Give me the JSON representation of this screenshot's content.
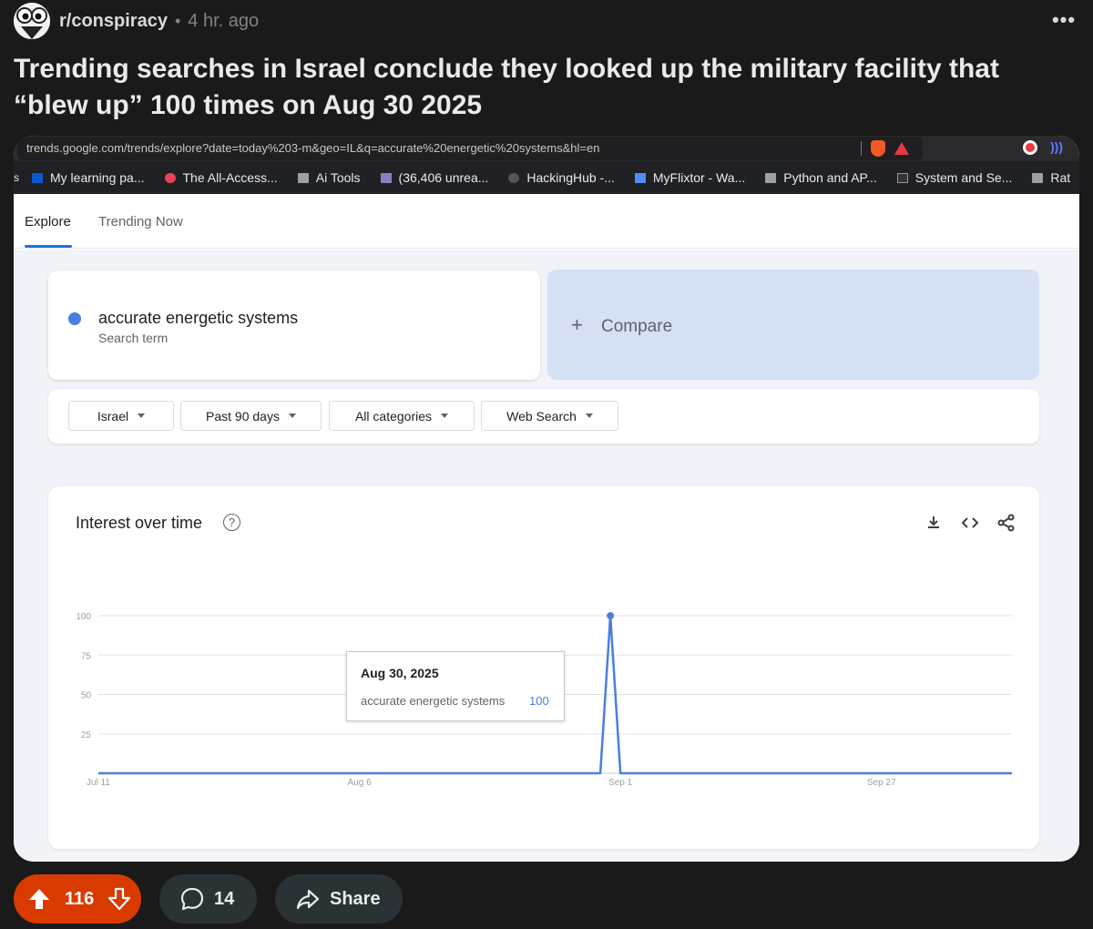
{
  "post": {
    "subreddit": "r/conspiracy",
    "separator": "•",
    "time": "4 hr. ago",
    "more": "•••",
    "title": "Trending searches in Israel conclude they looked up the military facility that “blew up” 100 times on Aug 30 2025",
    "votes": "116",
    "comments": "14",
    "share_label": "Share"
  },
  "browser": {
    "url": "trends.google.com/trends/explore?date=today%203-m&geo=IL&q=accurate%20energetic%20systems&hl=en",
    "bookmarks": [
      {
        "label": "My learning pa..."
      },
      {
        "label": "The All-Access..."
      },
      {
        "label": "Ai Tools"
      },
      {
        "label": "(36,406 unrea..."
      },
      {
        "label": "HackingHub -..."
      },
      {
        "label": "MyFlixtor - Wa..."
      },
      {
        "label": "Python and AP..."
      },
      {
        "label": "System and Se..."
      },
      {
        "label": "Rat"
      }
    ]
  },
  "trends": {
    "tabs": [
      "Explore",
      "Trending Now"
    ],
    "search_term": "accurate energetic systems",
    "search_term_sub": "Search term",
    "compare_label": "Compare",
    "filters": {
      "region": "Israel",
      "period": "Past 90 days",
      "category": "All categories",
      "source": "Web Search"
    },
    "card_title": "Interest over time",
    "help": "?"
  },
  "chart_data": {
    "type": "line",
    "series": [
      {
        "name": "accurate energetic systems",
        "color": "#4a7fe0",
        "x_days": [
          0,
          49,
          50,
          51,
          52,
          91
        ],
        "values": [
          0,
          0,
          0,
          100,
          0,
          0
        ]
      }
    ],
    "yticks": [
      "100",
      "75",
      "50",
      "25"
    ],
    "xticks": [
      {
        "label": "Jul 11",
        "day": 0
      },
      {
        "label": "Aug 6",
        "day": 26
      },
      {
        "label": "Sep 1",
        "day": 52
      },
      {
        "label": "Sep 27",
        "day": 78
      }
    ],
    "ylim": [
      0,
      100
    ],
    "grid": true,
    "tooltip": {
      "date": "Aug 30, 2025",
      "series": "accurate energetic systems",
      "value": "100"
    }
  }
}
